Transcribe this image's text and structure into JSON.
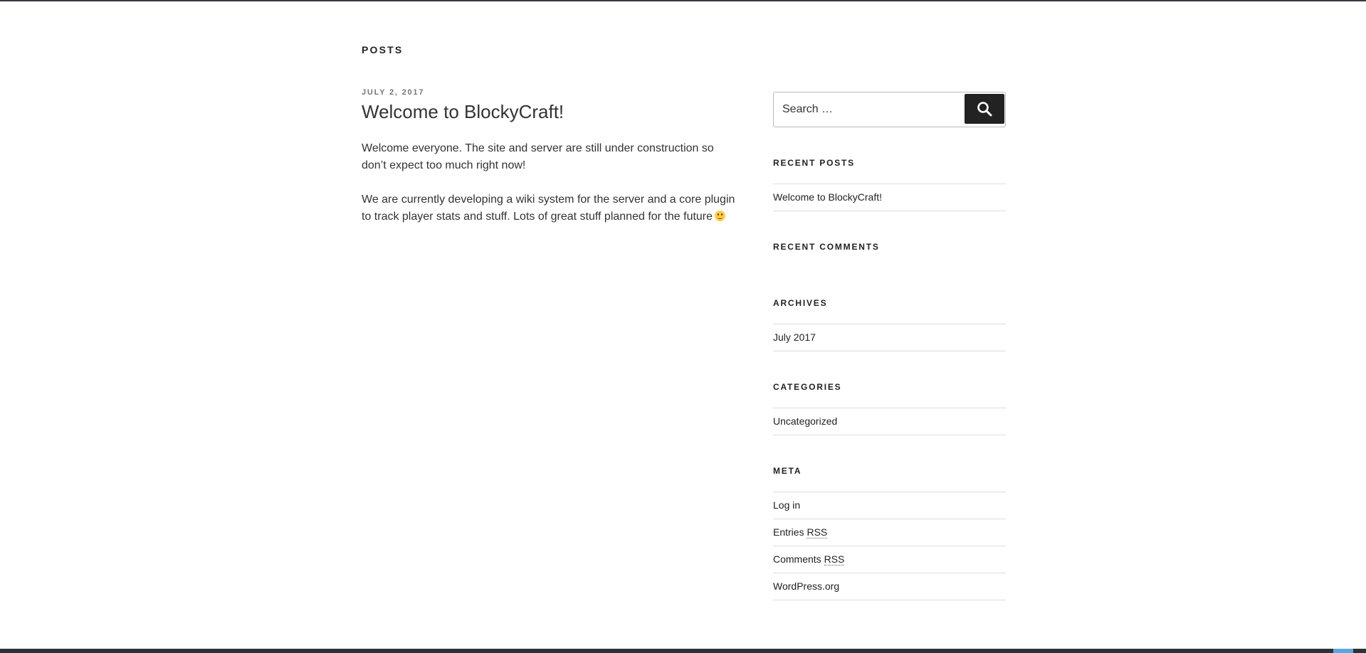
{
  "page": {
    "header": "POSTS"
  },
  "post": {
    "date": "JULY 2, 2017",
    "title": "Welcome to BlockyCraft!",
    "paragraph1": "Welcome everyone. The site and server are still under construction so don’t expect too much right now!",
    "paragraph2": "We are currently developing a wiki system for the server and a core plugin to track player stats and stuff. Lots of great stuff planned for the future",
    "emoji_icon": "slightly-smiling-face-icon"
  },
  "search": {
    "placeholder": "Search …",
    "button_icon": "search-icon",
    "button_label": "Search"
  },
  "widgets": {
    "recent_posts": {
      "title": "RECENT POSTS",
      "items": [
        "Welcome to BlockyCraft!"
      ]
    },
    "recent_comments": {
      "title": "RECENT COMMENTS"
    },
    "archives": {
      "title": "ARCHIVES",
      "items": [
        "July 2017"
      ]
    },
    "categories": {
      "title": "CATEGORIES",
      "items": [
        "Uncategorized"
      ]
    },
    "meta": {
      "title": "META",
      "items": [
        "Log in",
        "Entries",
        "RSS",
        "Comments",
        "RSS",
        "WordPress.org"
      ]
    }
  },
  "colors": {
    "text": "#333333",
    "heading": "#222222",
    "muted": "#767676",
    "divider": "#dddddd",
    "button_bg": "#222222"
  }
}
